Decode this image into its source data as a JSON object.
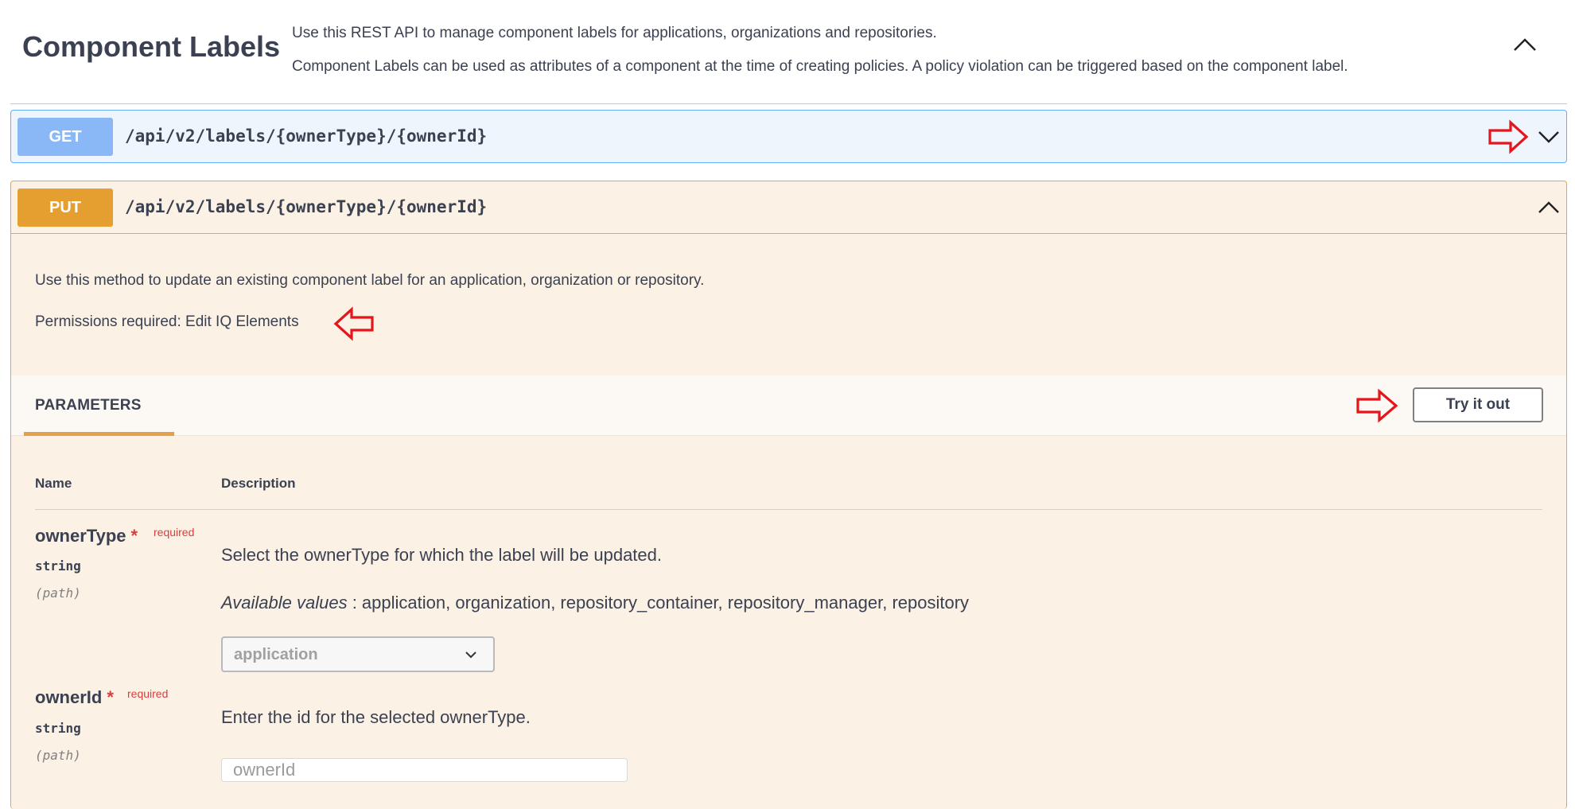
{
  "section": {
    "title": "Component Labels",
    "description_1": "Use this REST API to manage component labels for applications, organizations and repositories.",
    "description_2": "Component Labels can be used as attributes of a component at the time of creating policies. A policy violation can be triggered based on the component label."
  },
  "operations": {
    "get": {
      "method": "GET",
      "path": "/api/v2/labels/{ownerType}/{ownerId}"
    },
    "put": {
      "method": "PUT",
      "path": "/api/v2/labels/{ownerType}/{ownerId}",
      "description": "Use this method to update an existing component label for an application, organization or repository.",
      "permissions": "Permissions required: Edit IQ Elements",
      "parameters_tab": "PARAMETERS",
      "try_button": "Try it out",
      "table_headers": {
        "name": "Name",
        "description": "Description"
      },
      "params": [
        {
          "name": "ownerType",
          "star": "*",
          "required": "required",
          "type": "string",
          "in": "(path)",
          "description": "Select the ownerType for which the label will be updated.",
          "available_label": "Available values",
          "available_values": " : application, organization, repository_container, repository_manager, repository",
          "selected": "application"
        },
        {
          "name": "ownerId",
          "star": "*",
          "required": "required",
          "type": "string",
          "in": "(path)",
          "description": "Enter the id for the selected ownerType.",
          "placeholder": "ownerId"
        }
      ]
    }
  },
  "colors": {
    "get_accent": "#61affe",
    "put_accent": "#fca130",
    "annotation_arrow": "#e3161c"
  },
  "icons": {
    "collapse": "chevron-up-icon",
    "expand": "chevron-down-icon",
    "annotation": "red-arrow-icon"
  }
}
